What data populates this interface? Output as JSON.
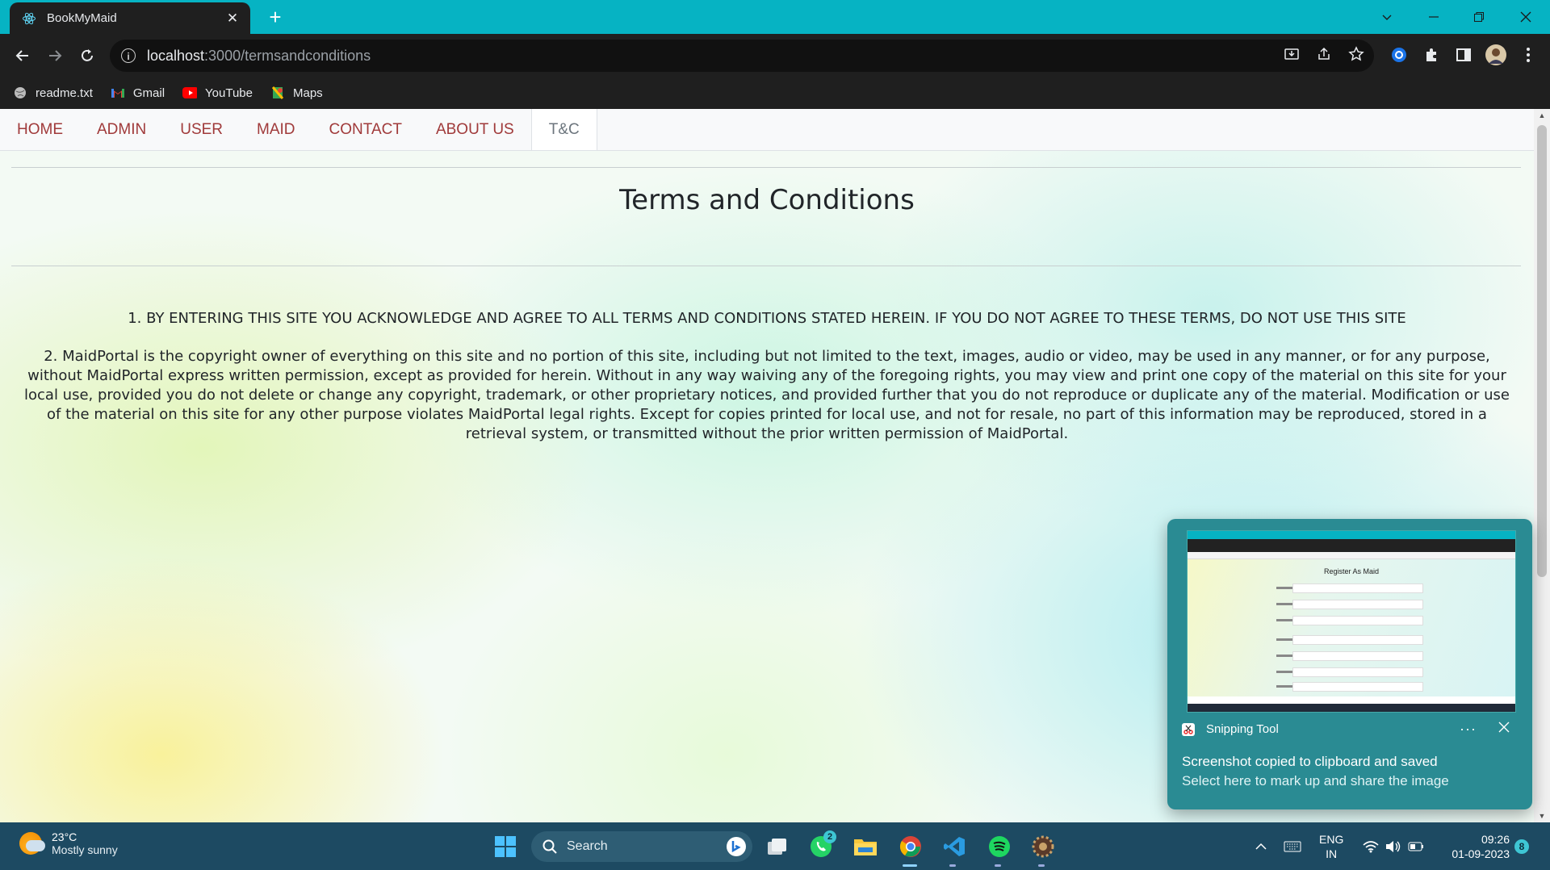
{
  "browser": {
    "tab_title": "BookMyMaid",
    "url_host": "localhost",
    "url_path": ":3000/termsandconditions",
    "bookmarks": [
      {
        "label": "readme.txt",
        "icon": "globe-icon"
      },
      {
        "label": "Gmail",
        "icon": "gmail-icon"
      },
      {
        "label": "YouTube",
        "icon": "youtube-icon"
      },
      {
        "label": "Maps",
        "icon": "maps-icon"
      }
    ]
  },
  "nav": {
    "links": [
      "HOME",
      "ADMIN",
      "USER",
      "MAID",
      "CONTACT",
      "ABOUT US",
      "T&C"
    ],
    "active": "T&C"
  },
  "page": {
    "heading": "Terms and Conditions",
    "terms": [
      "1. BY ENTERING THIS SITE YOU ACKNOWLEDGE AND AGREE TO ALL TERMS AND CONDITIONS STATED HEREIN. IF YOU DO NOT AGREE TO THESE TERMS, DO NOT USE THIS SITE",
      "2. MaidPortal is the copyright owner of everything on this site and no portion of this site, including but not limited to the text, images, audio or video, may be used in any manner, or for any purpose, without MaidPortal express written permission, except as provided for herein. Without in any way waiving any of the foregoing rights, you may view and print one copy of the material on this site for your local use, provided you do not delete or change any copyright, trademark, or other proprietary notices, and provided further that you do not reproduce or duplicate any of the material. Modification or use of the material on this site for any other purpose violates MaidPortal legal rights. Except for copies printed for local use, and not for resale, no part of this information may be reproduced, stored in a retrieval system, or transmitted without the prior written permission of MaidPortal."
    ]
  },
  "toast": {
    "app_name": "Snipping Tool",
    "more": "···",
    "message": "Screenshot copied to clipboard and saved",
    "sub_message": "Select here to mark up and share the image",
    "thumbnail_title": "Register As Maid"
  },
  "taskbar": {
    "temperature": "23°C",
    "weather": "Mostly sunny",
    "search_placeholder": "Search",
    "whatsapp_badge": "2",
    "lang_top": "ENG",
    "lang_bottom": "IN",
    "time": "09:26",
    "date": "01-09-2023",
    "notifications": "8"
  },
  "colors": {
    "tab_strip": "#06b3c3",
    "nav_link": "#a03a3a",
    "taskbar": "#1d4a62",
    "toast": "#2a8b93"
  }
}
